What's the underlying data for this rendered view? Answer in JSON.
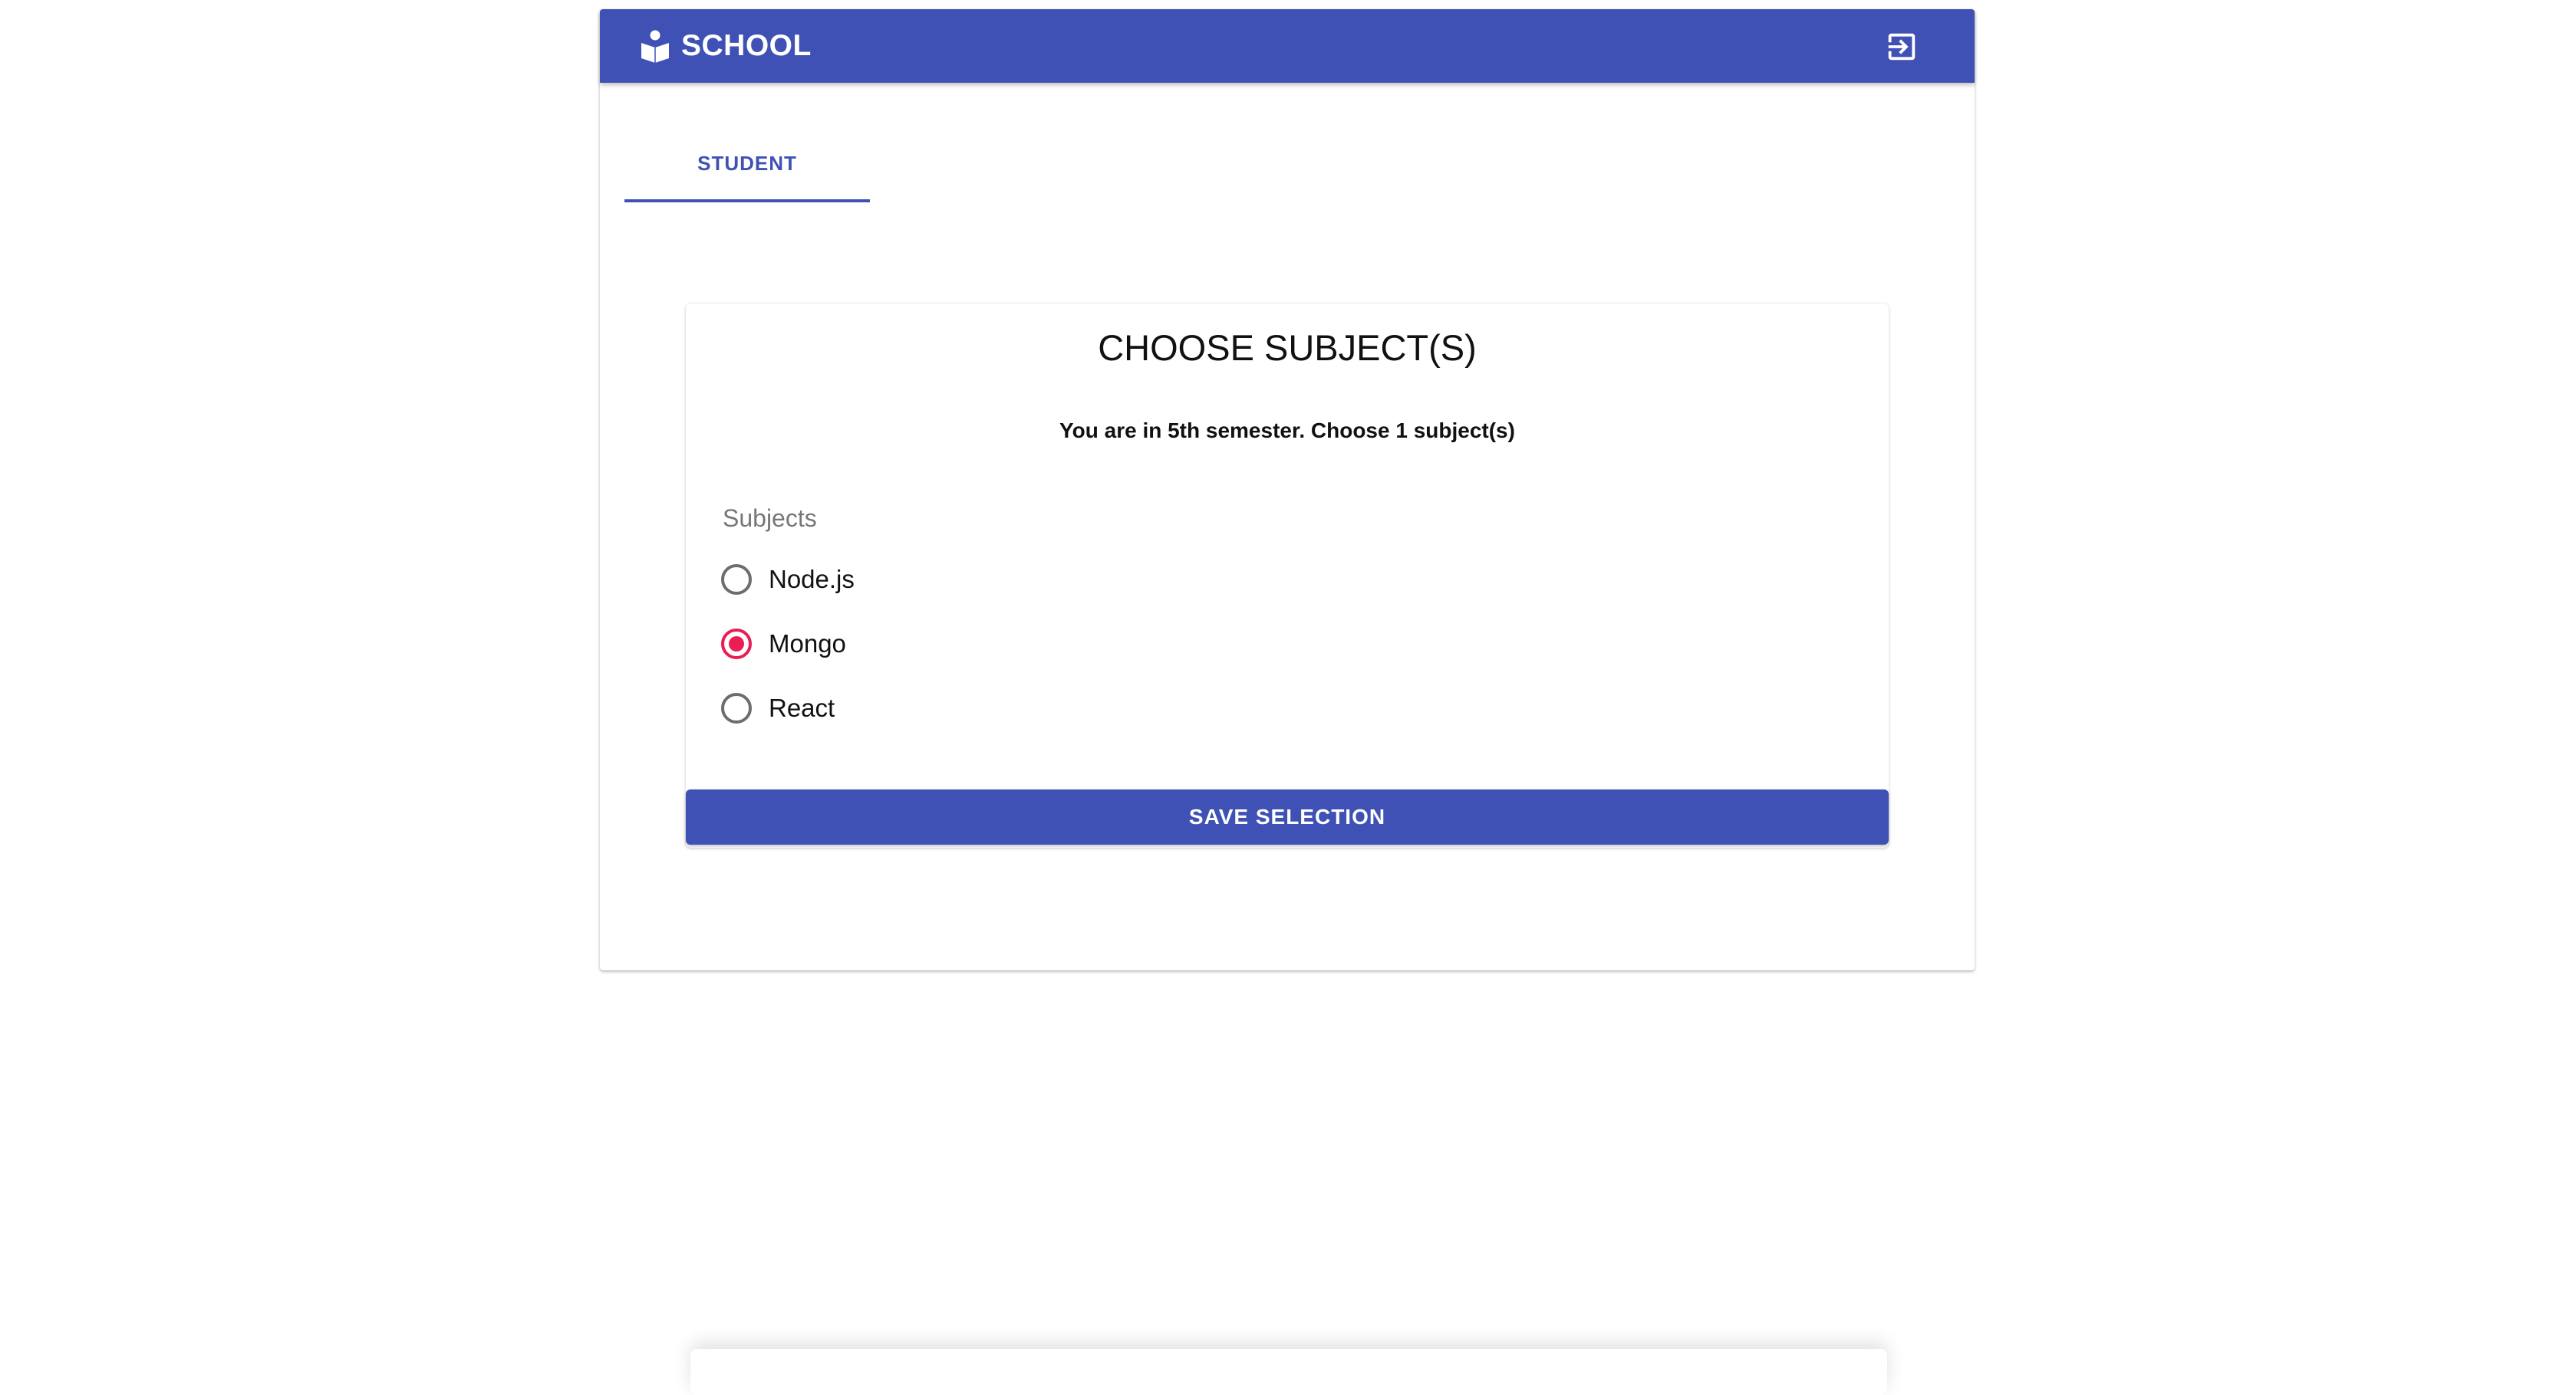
{
  "header": {
    "app_title": "SCHOOL",
    "brand_icon": "reading-person-icon",
    "logout_icon": "exit-to-app-icon",
    "color": "#3f51b5"
  },
  "tabs": [
    {
      "label": "STUDENT",
      "selected": true
    }
  ],
  "card": {
    "title": "CHOOSE SUBJECT(S)",
    "subtitle": "You are in 5th semester. Choose 1 subject(s)",
    "field_label": "Subjects",
    "options": [
      {
        "label": "Node.js",
        "checked": false
      },
      {
        "label": "Mongo",
        "checked": true
      },
      {
        "label": "React",
        "checked": false
      }
    ],
    "save_label": "SAVE SELECTION",
    "checked_color": "#e91e53"
  }
}
